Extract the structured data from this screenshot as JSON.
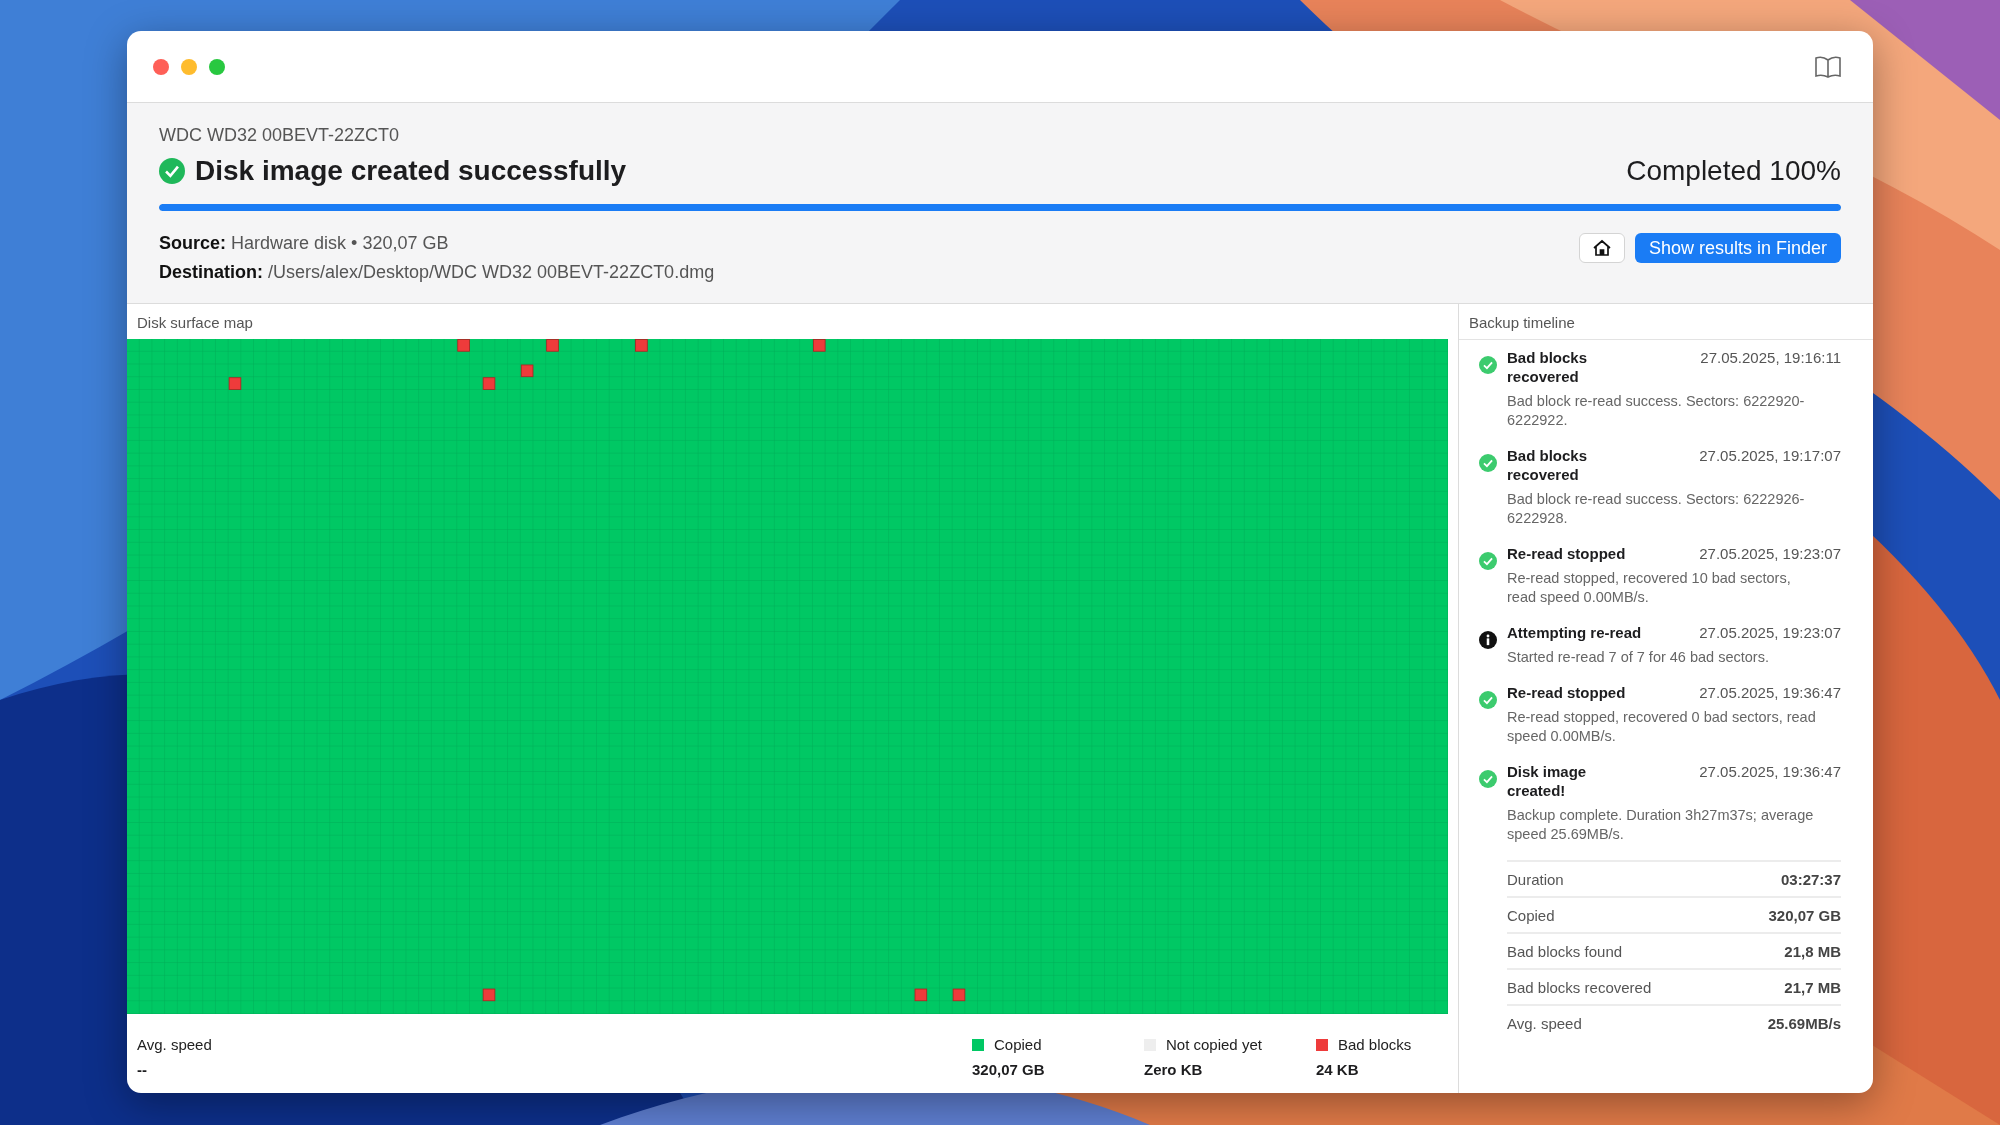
{
  "device": "WDC WD32 00BEVT-22ZCT0",
  "status": {
    "kind": "success",
    "title": "Disk image created successfully",
    "progress_label": "Completed 100%",
    "level": 1
  },
  "source": {
    "label": "Source:",
    "value": "Hardware disk • 320,07 GB"
  },
  "destination": {
    "label": "Destination:",
    "value": "/Users/alex/Desktop/WDC WD32 00BEVT-22ZCT0.dmg"
  },
  "buttons": [
    {
      "kind": "home"
    },
    {
      "kind": "primary",
      "label": "Show results in Finder"
    }
  ],
  "map": {
    "title": "Disk surface map"
  },
  "footer": {
    "avg_speed": {
      "label": "Avg. speed",
      "value": "--"
    },
    "legend": [
      {
        "label": "Copied",
        "value": "320,07 GB",
        "color": "#00c864"
      },
      {
        "label": "Not copied yet",
        "value": "Zero KB",
        "color": "#eeeeee"
      },
      {
        "label": "Bad blocks",
        "value": "24 KB",
        "color": "#ee3b3b"
      }
    ]
  },
  "timeline": {
    "title": "Backup timeline",
    "events": [
      {
        "kind": "success",
        "title": "Bad blocks recovered",
        "time": "27.05.2025, 19:16:11",
        "text": "Bad block re-read success. Sectors: 6222920-6222922."
      },
      {
        "kind": "success",
        "title": "Bad blocks recovered",
        "time": "27.05.2025, 19:17:07",
        "text": "Bad block re-read success. Sectors: 6222926-6222928."
      },
      {
        "kind": "success",
        "title": "Re-read stopped",
        "time": "27.05.2025, 19:23:07",
        "text": "Re-read stopped, recovered 10 bad sectors, read speed 0.00MB/s."
      },
      {
        "kind": "info",
        "title": "Attempting re-read",
        "time": "27.05.2025, 19:23:07",
        "text": "Started re-read 7 of 7 for 46 bad sectors."
      },
      {
        "kind": "success",
        "title": "Re-read stopped",
        "time": "27.05.2025, 19:36:47",
        "text": "Re-read stopped, recovered 0 bad sectors, read speed 0.00MB/s."
      },
      {
        "kind": "success",
        "title": "Disk image created!",
        "time": "27.05.2025, 19:36:47",
        "text": "Backup complete. Duration 3h27m37s; average speed 25.69MB/s."
      }
    ],
    "stats": [
      {
        "label": "Duration",
        "value": "03:27:37"
      },
      {
        "label": "Copied",
        "value": "320,07 GB"
      },
      {
        "label": "Bad blocks found",
        "value": "21,8 MB"
      },
      {
        "label": "Bad blocks recovered",
        "value": "21,7 MB"
      },
      {
        "label": "Avg. speed",
        "value": "25.69MB/s"
      }
    ]
  }
}
